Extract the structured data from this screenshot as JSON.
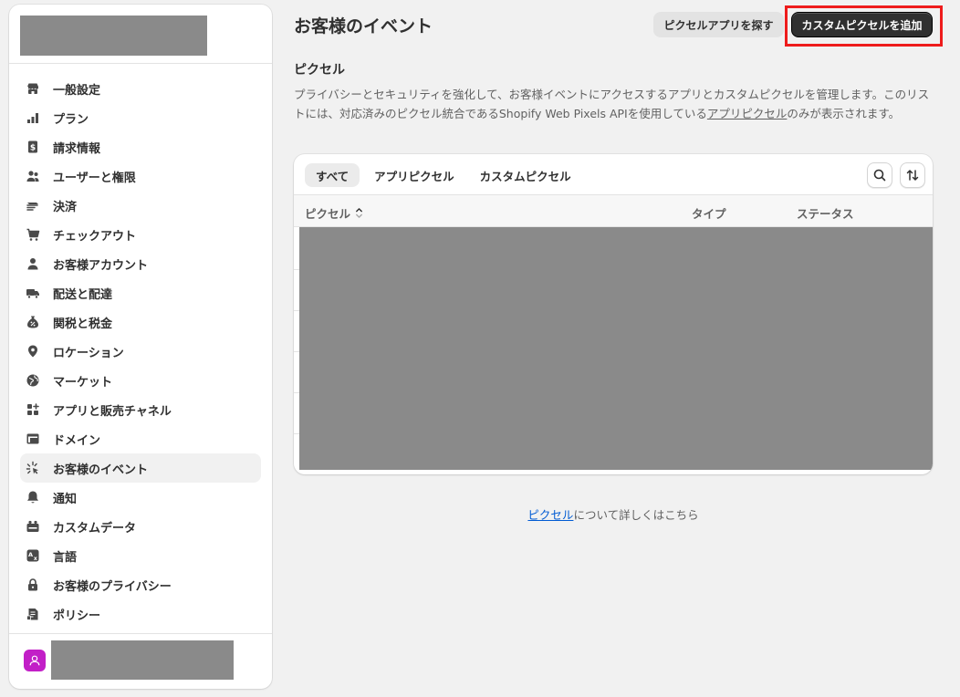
{
  "sidebar": {
    "items": [
      {
        "label": "一般設定",
        "icon": "store-icon"
      },
      {
        "label": "プラン",
        "icon": "plan-chart-icon"
      },
      {
        "label": "請求情報",
        "icon": "billing-icon"
      },
      {
        "label": "ユーザーと権限",
        "icon": "users-icon"
      },
      {
        "label": "決済",
        "icon": "payments-icon"
      },
      {
        "label": "チェックアウト",
        "icon": "cart-icon"
      },
      {
        "label": "お客様アカウント",
        "icon": "person-icon"
      },
      {
        "label": "配送と配達",
        "icon": "truck-icon"
      },
      {
        "label": "関税と税金",
        "icon": "tax-bag-icon"
      },
      {
        "label": "ロケーション",
        "icon": "location-pin-icon"
      },
      {
        "label": "マーケット",
        "icon": "globe-icon"
      },
      {
        "label": "アプリと販売チャネル",
        "icon": "apps-icon"
      },
      {
        "label": "ドメイン",
        "icon": "domain-icon"
      },
      {
        "label": "お客様のイベント",
        "icon": "cursor-click-icon",
        "active": true
      },
      {
        "label": "通知",
        "icon": "bell-icon"
      },
      {
        "label": "カスタムデータ",
        "icon": "custom-data-icon"
      },
      {
        "label": "言語",
        "icon": "language-icon"
      },
      {
        "label": "お客様のプライバシー",
        "icon": "lock-icon"
      },
      {
        "label": "ポリシー",
        "icon": "policy-icon"
      }
    ]
  },
  "header": {
    "title": "お客様のイベント",
    "secondary_button": "ピクセルアプリを探す",
    "primary_button": "カスタムピクセルを追加"
  },
  "section": {
    "title": "ピクセル",
    "desc_part1": "プライバシーとセキュリティを強化して、お客様イベントにアクセスするアプリとカスタムピクセルを管理します。このリストには、対応済みのピクセル統合であるShopify Web Pixels APIを使用している",
    "desc_link": "アプリピクセル",
    "desc_part2": "のみが表示されます。"
  },
  "table": {
    "tabs": [
      "すべて",
      "アプリピクセル",
      "カスタムピクセル"
    ],
    "active_tab": 0,
    "columns": [
      "ピクセル",
      "タイプ",
      "ステータス"
    ]
  },
  "footer": {
    "link": "ピクセル",
    "text": "について詳しくはこちら"
  },
  "colors": {
    "primary_button": "#303030",
    "highlight": "#ee1c1c",
    "avatar": "#c21fc7",
    "link": "#005bd3"
  }
}
